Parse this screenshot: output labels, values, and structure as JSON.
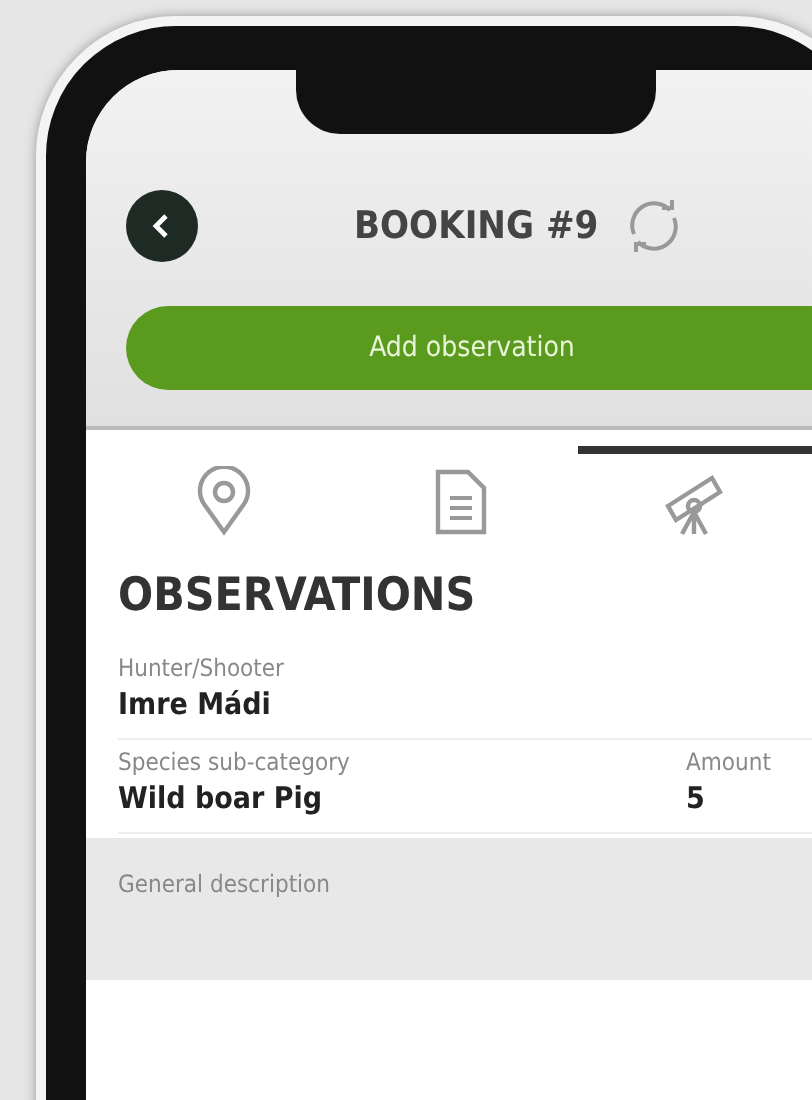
{
  "header": {
    "title": "BOOKING #9"
  },
  "primary_button": {
    "label": "Add observation"
  },
  "tabs": [
    {
      "kind": "location",
      "selected": false
    },
    {
      "kind": "document",
      "selected": false
    },
    {
      "kind": "telescope",
      "selected": true
    }
  ],
  "section_title": "OBSERVATIONS",
  "fields": [
    {
      "label": "Hunter/Shooter",
      "value": "Imre Mádi"
    },
    {
      "label": "Species sub-category",
      "value": "Wild boar Pig",
      "side_label": "Amount",
      "side_value": "5"
    }
  ],
  "description": {
    "label": "General description"
  }
}
